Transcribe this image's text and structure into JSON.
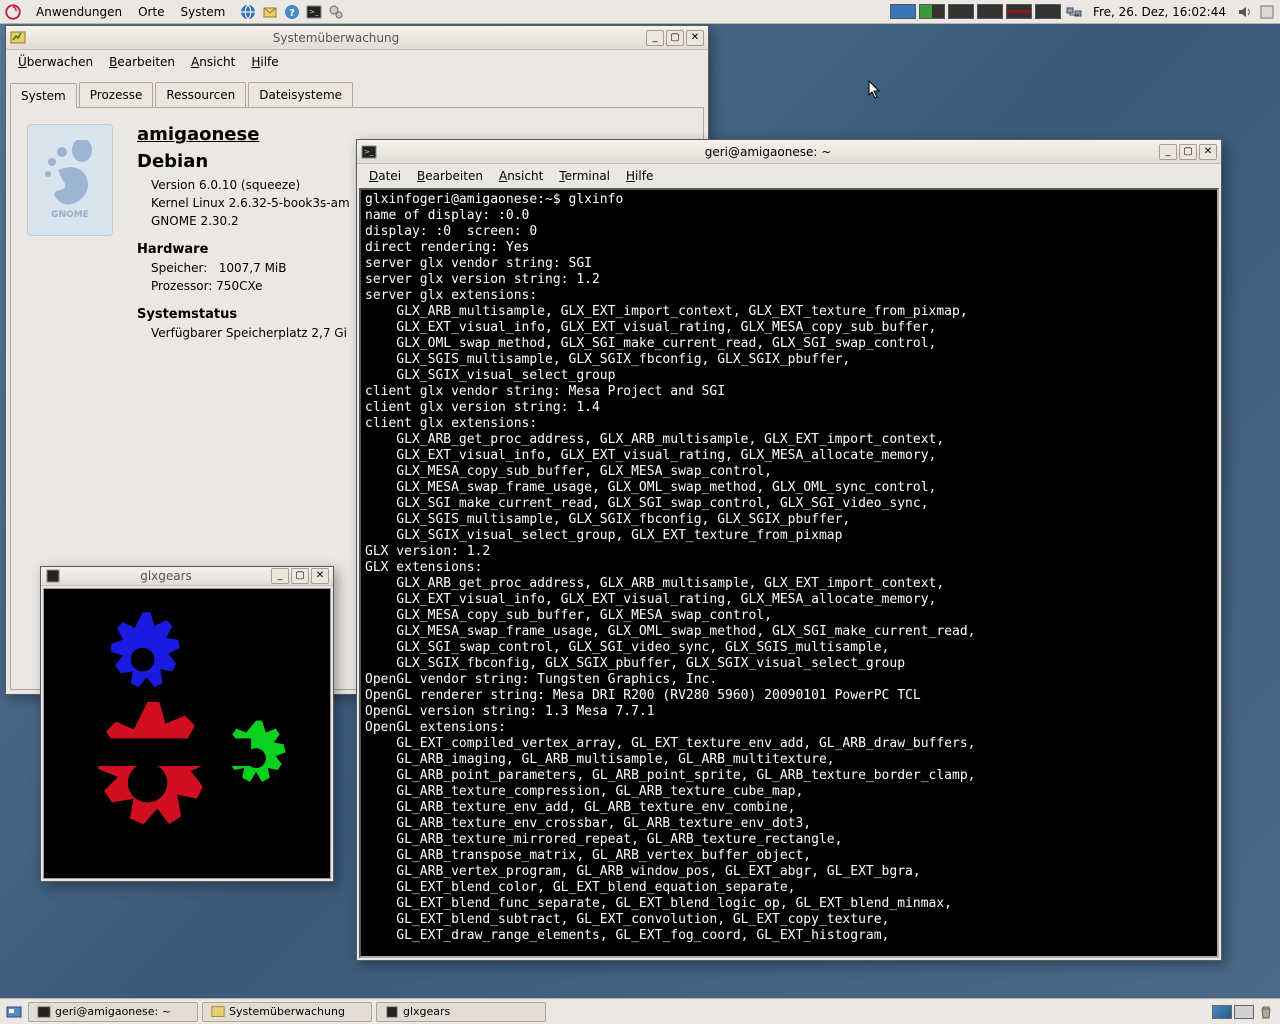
{
  "panel": {
    "menus": [
      "Anwendungen",
      "Orte",
      "System"
    ],
    "clock": "Fre, 26. Dez, 16:02:44"
  },
  "taskbar": {
    "items": [
      "geri@amigaonese: ~",
      "Systemüberwachung",
      "glxgears"
    ]
  },
  "sm": {
    "title": "Systemüberwachung",
    "menus": [
      "Überwachen",
      "Bearbeiten",
      "Ansicht",
      "Hilfe"
    ],
    "tabs": [
      "System",
      "Prozesse",
      "Ressourcen",
      "Dateisysteme"
    ],
    "hostname": "amigaonese",
    "distro": "Debian",
    "version_line": "Version 6.0.10 (squeeze)",
    "kernel_line": "Kernel Linux 2.6.32-5-book3s-am",
    "gnome_line": "GNOME 2.30.2",
    "hardware_label": "Hardware",
    "mem_label": "Speicher:",
    "mem_val": "1007,7 MiB",
    "cpu_label": "Prozessor:",
    "cpu_val": "750CXe",
    "status_label": "Systemstatus",
    "disk_line": "Verfügbarer Speicherplatz 2,7 Gi",
    "gnome_text": "GNOME"
  },
  "gears": {
    "title": "glxgears"
  },
  "term": {
    "title": "geri@amigaonese: ~",
    "menus": [
      "Datei",
      "Bearbeiten",
      "Ansicht",
      "Terminal",
      "Hilfe"
    ],
    "output": "glxinfogeri@amigaonese:~$ glxinfo\nname of display: :0.0\ndisplay: :0  screen: 0\ndirect rendering: Yes\nserver glx vendor string: SGI\nserver glx version string: 1.2\nserver glx extensions:\n    GLX_ARB_multisample, GLX_EXT_import_context, GLX_EXT_texture_from_pixmap,\n    GLX_EXT_visual_info, GLX_EXT_visual_rating, GLX_MESA_copy_sub_buffer,\n    GLX_OML_swap_method, GLX_SGI_make_current_read, GLX_SGI_swap_control,\n    GLX_SGIS_multisample, GLX_SGIX_fbconfig, GLX_SGIX_pbuffer,\n    GLX_SGIX_visual_select_group\nclient glx vendor string: Mesa Project and SGI\nclient glx version string: 1.4\nclient glx extensions:\n    GLX_ARB_get_proc_address, GLX_ARB_multisample, GLX_EXT_import_context,\n    GLX_EXT_visual_info, GLX_EXT_visual_rating, GLX_MESA_allocate_memory,\n    GLX_MESA_copy_sub_buffer, GLX_MESA_swap_control,\n    GLX_MESA_swap_frame_usage, GLX_OML_swap_method, GLX_OML_sync_control,\n    GLX_SGI_make_current_read, GLX_SGI_swap_control, GLX_SGI_video_sync,\n    GLX_SGIS_multisample, GLX_SGIX_fbconfig, GLX_SGIX_pbuffer,\n    GLX_SGIX_visual_select_group, GLX_EXT_texture_from_pixmap\nGLX version: 1.2\nGLX extensions:\n    GLX_ARB_get_proc_address, GLX_ARB_multisample, GLX_EXT_import_context,\n    GLX_EXT_visual_info, GLX_EXT_visual_rating, GLX_MESA_allocate_memory,\n    GLX_MESA_copy_sub_buffer, GLX_MESA_swap_control,\n    GLX_MESA_swap_frame_usage, GLX_OML_swap_method, GLX_SGI_make_current_read,\n    GLX_SGI_swap_control, GLX_SGI_video_sync, GLX_SGIS_multisample,\n    GLX_SGIX_fbconfig, GLX_SGIX_pbuffer, GLX_SGIX_visual_select_group\nOpenGL vendor string: Tungsten Graphics, Inc.\nOpenGL renderer string: Mesa DRI R200 (RV280 5960) 20090101 PowerPC TCL\nOpenGL version string: 1.3 Mesa 7.7.1\nOpenGL extensions:\n    GL_EXT_compiled_vertex_array, GL_EXT_texture_env_add, GL_ARB_draw_buffers,\n    GL_ARB_imaging, GL_ARB_multisample, GL_ARB_multitexture,\n    GL_ARB_point_parameters, GL_ARB_point_sprite, GL_ARB_texture_border_clamp,\n    GL_ARB_texture_compression, GL_ARB_texture_cube_map,\n    GL_ARB_texture_env_add, GL_ARB_texture_env_combine,\n    GL_ARB_texture_env_crossbar, GL_ARB_texture_env_dot3,\n    GL_ARB_texture_mirrored_repeat, GL_ARB_texture_rectangle,\n    GL_ARB_transpose_matrix, GL_ARB_vertex_buffer_object,\n    GL_ARB_vertex_program, GL_ARB_window_pos, GL_EXT_abgr, GL_EXT_bgra,\n    GL_EXT_blend_color, GL_EXT_blend_equation_separate,\n    GL_EXT_blend_func_separate, GL_EXT_blend_logic_op, GL_EXT_blend_minmax,\n    GL_EXT_blend_subtract, GL_EXT_convolution, GL_EXT_copy_texture,\n    GL_EXT_draw_range_elements, GL_EXT_fog_coord, GL_EXT_histogram,"
  }
}
